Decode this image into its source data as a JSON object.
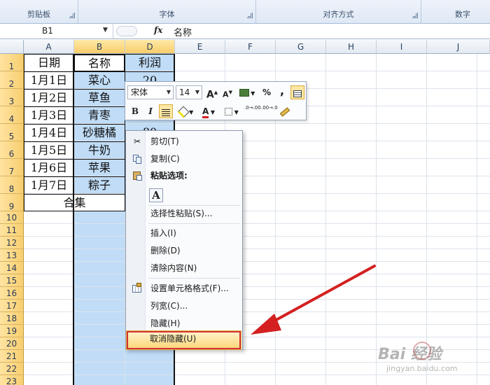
{
  "ribbon": {
    "groups": [
      {
        "label": "剪贴板"
      },
      {
        "label": "字体"
      },
      {
        "label": "对齐方式"
      },
      {
        "label": "数字"
      }
    ]
  },
  "formula_bar": {
    "name_box": "B1",
    "fx_label": "fx",
    "content": "名称"
  },
  "columns": [
    "A",
    "B",
    "D",
    "E",
    "F",
    "G",
    "H",
    "I",
    "J"
  ],
  "rows": [
    "1",
    "2",
    "3",
    "4",
    "5",
    "6",
    "7",
    "8",
    "9",
    "10",
    "11",
    "12",
    "13",
    "14",
    "15",
    "16",
    "17",
    "18",
    "19",
    "20",
    "21",
    "22",
    "23"
  ],
  "sheet": {
    "header": {
      "a": "日期",
      "b": "名称",
      "d": "利润"
    },
    "data": [
      {
        "a": "1月1日",
        "b": "菜心",
        "d": "20"
      },
      {
        "a": "1月2日",
        "b": "草鱼",
        "d": ""
      },
      {
        "a": "1月3日",
        "b": "青枣",
        "d": ""
      },
      {
        "a": "1月4日",
        "b": "砂糖橘",
        "d": "80"
      },
      {
        "a": "1月5日",
        "b": "牛奶",
        "d": ""
      },
      {
        "a": "1月6日",
        "b": "苹果",
        "d": ""
      },
      {
        "a": "1月7日",
        "b": "粽子",
        "d": ""
      }
    ],
    "total": "合集"
  },
  "mini_toolbar": {
    "font": "宋体",
    "size": "14",
    "grow": "A",
    "shrink": "A",
    "percent": "%",
    "comma": ",",
    "bold": "B",
    "italic": "I",
    "font_color": "A",
    "dec_increase": ".0→.00",
    "dec_decrease": ".00→.0"
  },
  "context_menu": {
    "items": [
      {
        "label": "剪切(T)"
      },
      {
        "label": "复制(C)"
      },
      {
        "label": "粘贴选项:"
      },
      {
        "label": "选择性粘贴(S)..."
      },
      {
        "label": "插入(I)"
      },
      {
        "label": "删除(D)"
      },
      {
        "label": "清除内容(N)"
      },
      {
        "label": "设置单元格格式(F)..."
      },
      {
        "label": "列宽(C)..."
      },
      {
        "label": "隐藏(H)"
      },
      {
        "label": "取消隐藏(U)"
      }
    ],
    "paste_icon": "A"
  },
  "watermark": {
    "brand": "Bai 经验",
    "url": "jingyan.baidu.com"
  },
  "colors": {
    "selection": "#c0dcf6",
    "row_header": "#f7cf70",
    "arrow": "#d42020",
    "highlight_border": "#d23333"
  }
}
